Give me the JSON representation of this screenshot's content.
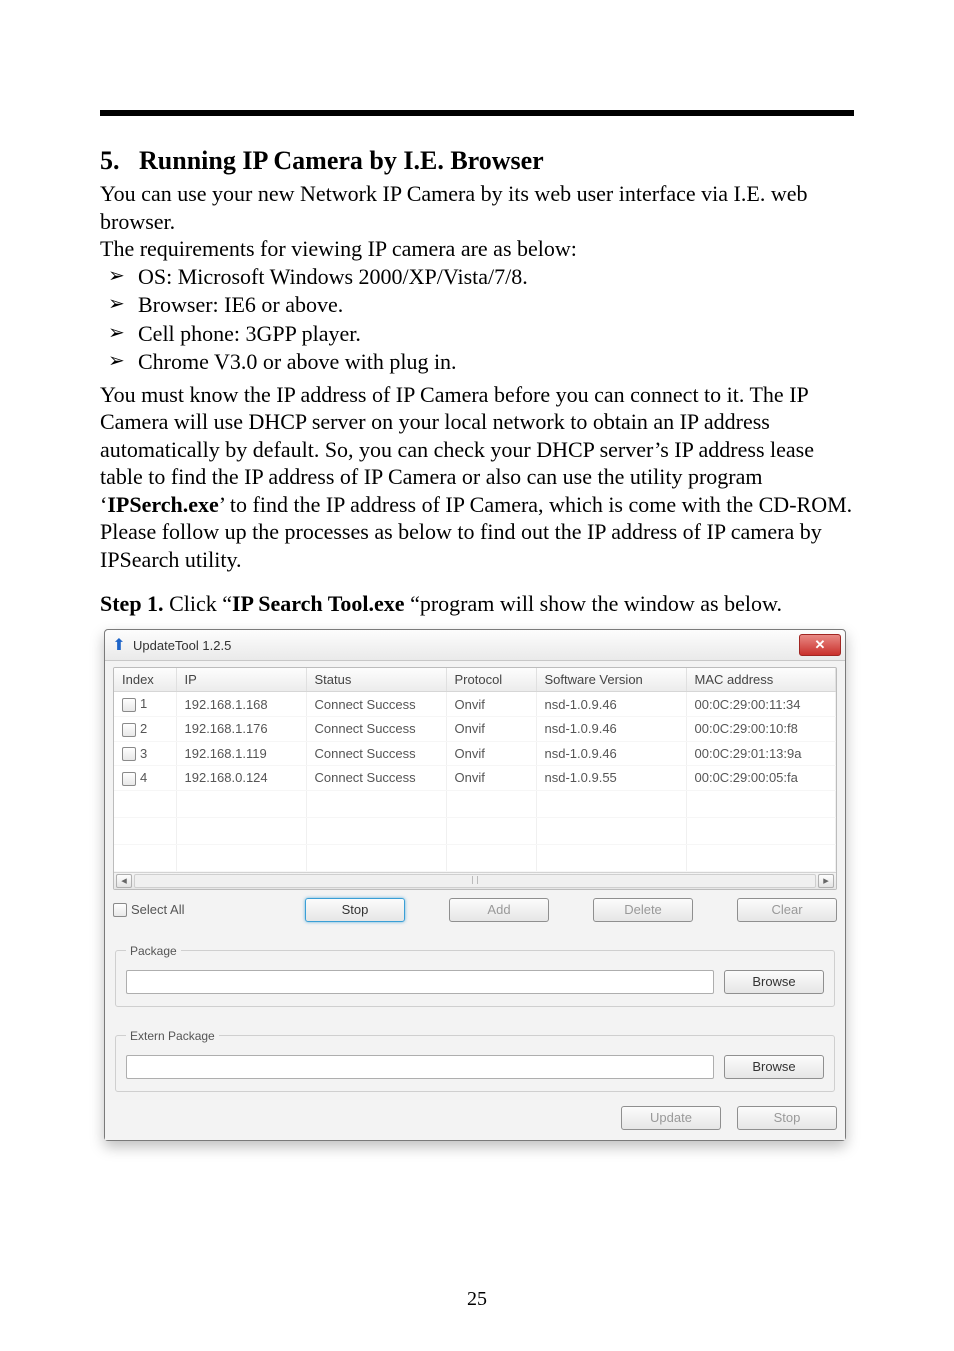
{
  "section": {
    "number": "5.",
    "title": "Running IP Camera by I.E. Browser"
  },
  "intro1": "You can use your new Network IP Camera by its web user interface via I.E. web browser.",
  "intro2": "The requirements for viewing IP camera are as below:",
  "requirements": [
    "OS: Microsoft Windows 2000/XP/Vista/7/8.",
    "Browser: IE6 or above.",
    "Cell phone: 3GPP player.",
    "Chrome V3.0 or above with plug in."
  ],
  "para2a": "You must know the IP address of IP Camera before you can connect to it.    The IP Camera will use DHCP server on your local network to obtain an IP address automatically by default.    So, you can check your DHCP server’s IP address lease table to find the IP address of IP Camera or also can use the utility program ‘",
  "para2b_bold": "IPSerch.exe",
  "para2c": "’ to find the IP address of IP Camera, which is come with the CD-ROM.",
  "para3": "Please follow up the processes as below to find out the IP address of IP camera by IPSearch utility.",
  "step1": {
    "label": "Step 1.",
    "pre": "  Click “",
    "bold": "IP Search Tool.exe ",
    "post": "“program will show the window as below."
  },
  "win": {
    "title": "UpdateTool 1.2.5",
    "columns": [
      "Index",
      "IP",
      "Status",
      "Protocol",
      "Software Version",
      "MAC address"
    ],
    "rows": [
      {
        "index": "1",
        "ip": "192.168.1.168",
        "status": "Connect Success",
        "protocol": "Onvif",
        "ver": "nsd-1.0.9.46",
        "mac": "00:0C:29:00:11:34"
      },
      {
        "index": "2",
        "ip": "192.168.1.176",
        "status": "Connect Success",
        "protocol": "Onvif",
        "ver": "nsd-1.0.9.46",
        "mac": "00:0C:29:00:10:f8"
      },
      {
        "index": "3",
        "ip": "192.168.1.119",
        "status": "Connect Success",
        "protocol": "Onvif",
        "ver": "nsd-1.0.9.46",
        "mac": "00:0C:29:01:13:9a"
      },
      {
        "index": "4",
        "ip": "192.168.0.124",
        "status": "Connect Success",
        "protocol": "Onvif",
        "ver": "nsd-1.0.9.55",
        "mac": "00:0C:29:00:05:fa"
      }
    ],
    "select_all": "Select All",
    "buttons": {
      "stop": "Stop",
      "add": "Add",
      "delete": "Delete",
      "clear": "Clear",
      "browse": "Browse",
      "update": "Update",
      "stop2": "Stop"
    },
    "groups": {
      "package": "Package",
      "extern": "Extern Package"
    }
  },
  "page_number": "25"
}
